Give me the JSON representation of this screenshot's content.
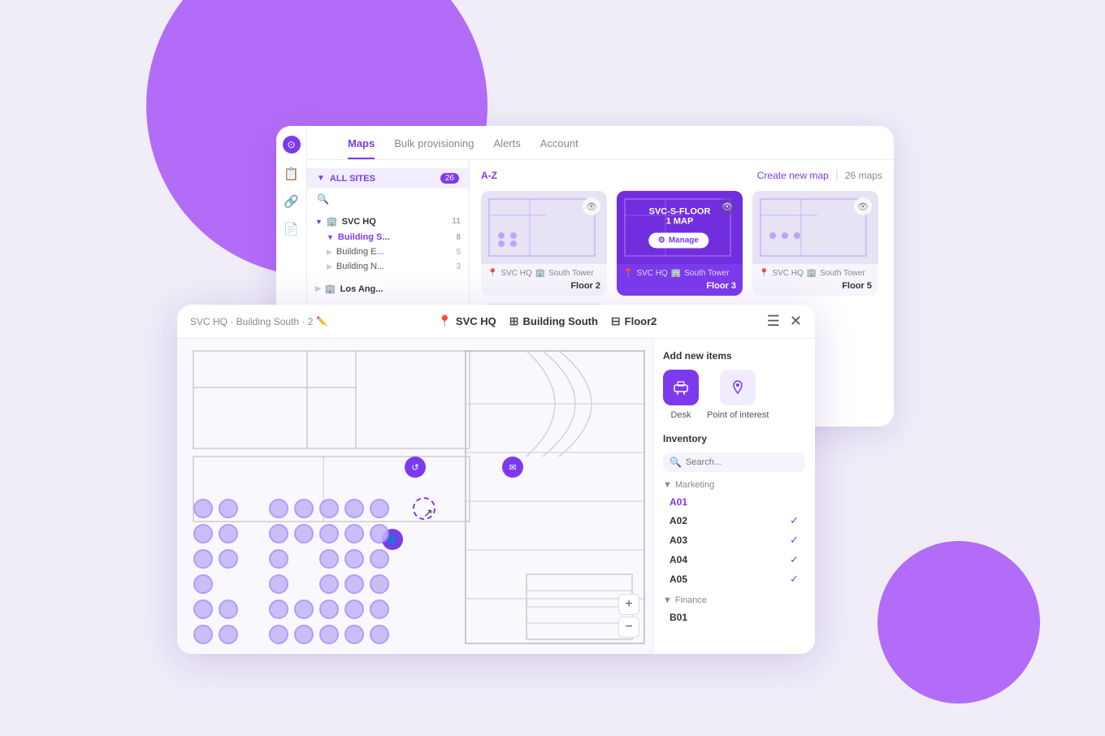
{
  "bg": {
    "primary_color": "#a855f7",
    "secondary_color": "#f0edf8"
  },
  "back_window": {
    "nav_tabs": [
      {
        "label": "Maps",
        "active": true
      },
      {
        "label": "Bulk provisioning",
        "active": false
      },
      {
        "label": "Alerts",
        "active": false
      },
      {
        "label": "Account",
        "active": false
      }
    ],
    "sidebar_icons": [
      "⊙",
      "📋",
      "🔗",
      "📄"
    ],
    "site_panel": {
      "all_sites_label": "ALL SITES",
      "all_sites_count": "26",
      "sites": [
        {
          "name": "SVC HQ",
          "count": "11",
          "children": [
            {
              "name": "Building S...",
              "count": "8"
            },
            {
              "name": "Building E...",
              "count": "5"
            },
            {
              "name": "Building N...",
              "count": "3"
            }
          ]
        },
        {
          "name": "Los Ang...",
          "count": "",
          "children": []
        }
      ]
    },
    "maps_toolbar": {
      "sort_label": "A-Z",
      "create_label": "Create new map",
      "separator": "|",
      "count_label": "26 maps"
    },
    "map_cards": [
      {
        "id": "card-1",
        "site": "SVC HQ",
        "building": "South Tower",
        "floor": "Floor 2",
        "active": false
      },
      {
        "id": "card-2",
        "site": "SVC HQ",
        "building": "South Tower",
        "floor": "Floor 3",
        "active": true,
        "overlay_title": "SVC-S-FLOOR 1 MAP",
        "overlay_btn": "Manage"
      },
      {
        "id": "card-3",
        "site": "SVC HQ",
        "building": "South Tower",
        "floor": "Floor 5",
        "active": false
      }
    ]
  },
  "front_window": {
    "breadcrumb": "SVC HQ · Building South · 2",
    "breadcrumb_edit_icon": "✏️",
    "location_parts": [
      {
        "icon": "📍",
        "label": "SVC HQ"
      },
      {
        "icon": "⊞",
        "label": "Building South"
      },
      {
        "icon": "⊟",
        "label": "Floor2"
      }
    ],
    "header_icons": [
      "☰",
      "✕"
    ],
    "right_panel": {
      "add_section_title": "Add new items",
      "add_items": [
        {
          "label": "Desk",
          "active": true
        },
        {
          "label": "Point of interest",
          "active": false
        }
      ],
      "inventory_title": "Inventory",
      "search_placeholder": "Search...",
      "groups": [
        {
          "name": "Marketing",
          "items": [
            {
              "name": "A01",
              "checked": false,
              "highlight": true
            },
            {
              "name": "A02",
              "checked": true
            },
            {
              "name": "A03",
              "checked": true
            },
            {
              "name": "A04",
              "checked": true
            },
            {
              "name": "A05",
              "checked": true
            }
          ]
        },
        {
          "name": "Finance",
          "items": [
            {
              "name": "B01",
              "checked": false
            }
          ]
        }
      ]
    },
    "zoom_controls": [
      "+",
      "−"
    ]
  }
}
